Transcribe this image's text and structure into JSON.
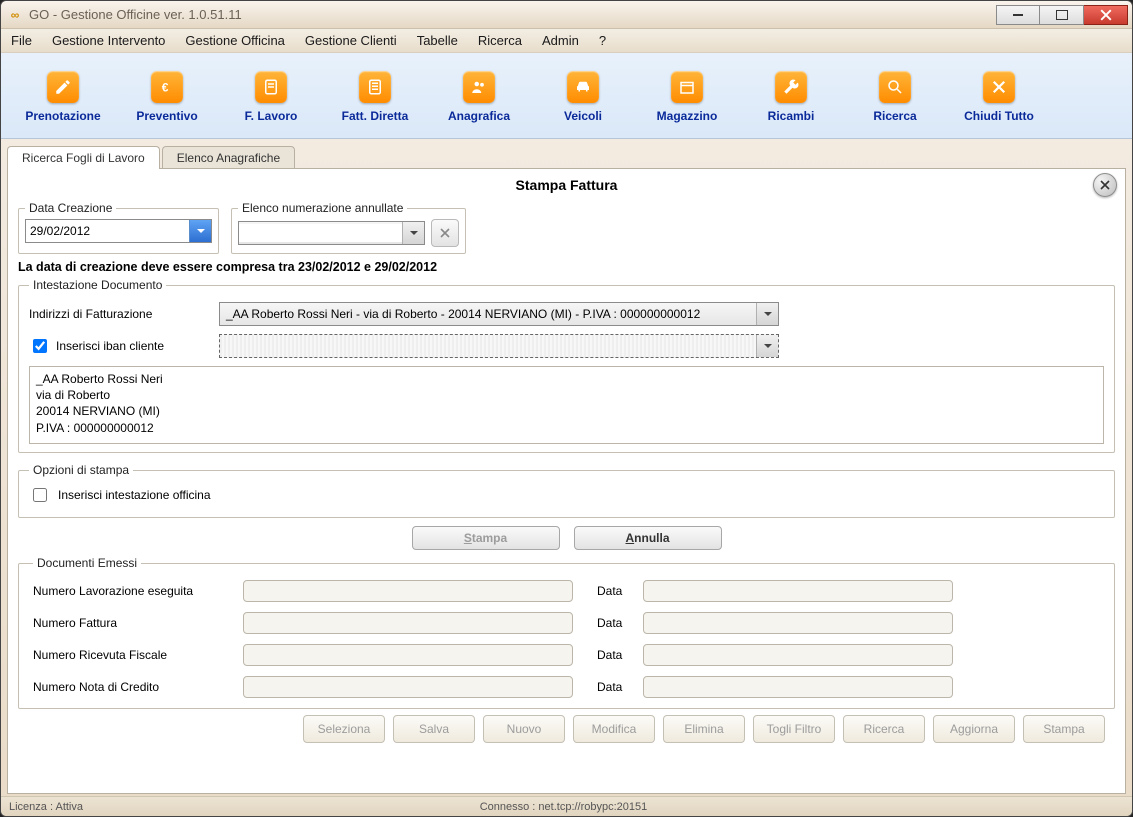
{
  "window": {
    "title": "GO - Gestione Officine ver. 1.0.51.11"
  },
  "menu": {
    "items": [
      "File",
      "Gestione Intervento",
      "Gestione Officina",
      "Gestione Clienti",
      "Tabelle",
      "Ricerca",
      "Admin",
      "?"
    ]
  },
  "toolbar": {
    "items": [
      {
        "label": "Prenotazione",
        "icon": "pencil-icon"
      },
      {
        "label": "Preventivo",
        "icon": "euro-icon"
      },
      {
        "label": "F. Lavoro",
        "icon": "sheet-icon"
      },
      {
        "label": "Fatt. Diretta",
        "icon": "sheet-lines-icon"
      },
      {
        "label": "Anagrafica",
        "icon": "people-icon"
      },
      {
        "label": "Veicoli",
        "icon": "car-icon"
      },
      {
        "label": "Magazzino",
        "icon": "box-icon"
      },
      {
        "label": "Ricambi",
        "icon": "wrench-icon"
      },
      {
        "label": "Ricerca",
        "icon": "search-icon"
      },
      {
        "label": "Chiudi Tutto",
        "icon": "close-icon"
      }
    ]
  },
  "tabs": {
    "items": [
      {
        "label": "Ricerca Fogli di Lavoro",
        "active": true
      },
      {
        "label": "Elenco Anagrafiche",
        "active": false
      }
    ]
  },
  "page": {
    "title": "Stampa Fattura",
    "data_creazione_legend": "Data Creazione",
    "data_creazione_value": "29/02/2012",
    "elenco_annullate_legend": "Elenco numerazione annullate",
    "elenco_annullate_value": "",
    "hint": "La data di creazione deve essere compresa tra 23/02/2012 e 29/02/2012",
    "intestazione": {
      "legend": "Intestazione Documento",
      "indirizzi_label": "Indirizzi di Fatturazione",
      "indirizzi_value": "_AA Roberto Rossi Neri - via di Roberto  - 20014 NERVIANO (MI) - P.IVA : 000000000012",
      "iban_check_label": "Inserisci iban cliente",
      "iban_checked": true,
      "iban_value": "",
      "address_lines": [
        "_AA Roberto Rossi Neri",
        "via di Roberto",
        "20014 NERVIANO (MI)",
        "P.IVA : 000000000012"
      ]
    },
    "opzioni": {
      "legend": "Opzioni di stampa",
      "officina_check_label": "Inserisci intestazione officina",
      "officina_checked": false
    },
    "buttons": {
      "stampa": "Stampa",
      "stampa_enabled": false,
      "annulla": "Annulla"
    },
    "emessi": {
      "legend": "Documenti Emessi",
      "data_label": "Data",
      "rows": [
        {
          "label": "Numero Lavorazione eseguita",
          "num": "",
          "data": ""
        },
        {
          "label": "Numero Fattura",
          "num": "",
          "data": ""
        },
        {
          "label": "Numero Ricevuta Fiscale",
          "num": "",
          "data": ""
        },
        {
          "label": "Numero Nota di Credito",
          "num": "",
          "data": ""
        }
      ]
    }
  },
  "bottom_buttons": [
    "Seleziona",
    "Salva",
    "Nuovo",
    "Modifica",
    "Elimina",
    "Togli Filtro",
    "Ricerca",
    "Aggiorna",
    "Stampa"
  ],
  "status": {
    "left": "Licenza : Attiva",
    "center": "Connesso : net.tcp://robypc:20151"
  }
}
